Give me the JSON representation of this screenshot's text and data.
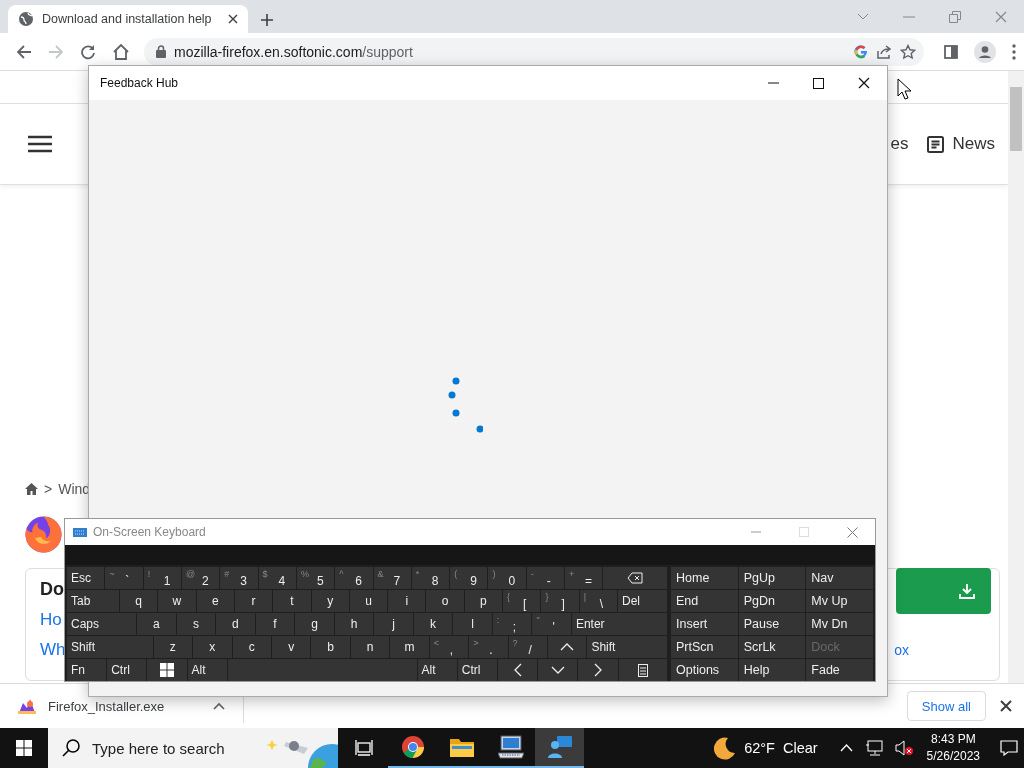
{
  "browser": {
    "tabs": [
      {
        "title": "Download and installation help",
        "selected": true
      }
    ],
    "nav": {
      "forward_disabled": true
    },
    "address": "mozilla-firefox.en.softonic.com/support"
  },
  "page": {
    "nav_items": [
      {
        "kind": "plain",
        "label": "es"
      },
      {
        "kind": "news",
        "label": "News"
      }
    ],
    "breadcrumb": {
      "separator": ">",
      "items": [
        "Wind"
      ]
    },
    "card": {
      "title": "Do",
      "links": [
        "Ho",
        "Wh"
      ],
      "side_link": "ox"
    }
  },
  "downloads": {
    "file": "Firefox_Installer.exe",
    "show_all": "Show all"
  },
  "feedback_hub": {
    "title": "Feedback Hub",
    "loading": true
  },
  "osk": {
    "title": "On-Screen Keyboard",
    "rows": [
      [
        {
          "kind": "key",
          "label": "Esc"
        },
        {
          "kind": "dual",
          "shift": "~",
          "label": "`"
        },
        {
          "kind": "dual",
          "shift": "!",
          "label": "1"
        },
        {
          "kind": "dual",
          "shift": "@",
          "label": "2"
        },
        {
          "kind": "dual",
          "shift": "#",
          "label": "3"
        },
        {
          "kind": "dual",
          "shift": "$",
          "label": "4"
        },
        {
          "kind": "dual",
          "shift": "%",
          "label": "5"
        },
        {
          "kind": "dual",
          "shift": "^",
          "label": "6"
        },
        {
          "kind": "dual",
          "shift": "&",
          "label": "7"
        },
        {
          "kind": "dual",
          "shift": "*",
          "label": "8"
        },
        {
          "kind": "dual",
          "shift": "(",
          "label": "9"
        },
        {
          "kind": "dual",
          "shift": ")",
          "label": "0"
        },
        {
          "kind": "dual",
          "shift": "-",
          "label": "-"
        },
        {
          "kind": "dual",
          "shift": "+",
          "label": "="
        },
        {
          "kind": "backspace"
        }
      ],
      [
        {
          "kind": "key",
          "label": "Tab"
        },
        {
          "kind": "key",
          "label": "q"
        },
        {
          "kind": "key",
          "label": "w"
        },
        {
          "kind": "key",
          "label": "e"
        },
        {
          "kind": "key",
          "label": "r"
        },
        {
          "kind": "key",
          "label": "t"
        },
        {
          "kind": "key",
          "label": "y"
        },
        {
          "kind": "key",
          "label": "u"
        },
        {
          "kind": "key",
          "label": "i"
        },
        {
          "kind": "key",
          "label": "o"
        },
        {
          "kind": "key",
          "label": "p"
        },
        {
          "kind": "dual",
          "shift": "{",
          "label": "["
        },
        {
          "kind": "dual",
          "shift": "}",
          "label": "]"
        },
        {
          "kind": "dual",
          "shift": "|",
          "label": "\\"
        },
        {
          "kind": "key",
          "label": "Del"
        }
      ],
      [
        {
          "kind": "key",
          "label": "Caps"
        },
        {
          "kind": "key",
          "label": "a"
        },
        {
          "kind": "key",
          "label": "s"
        },
        {
          "kind": "key",
          "label": "d"
        },
        {
          "kind": "key",
          "label": "f"
        },
        {
          "kind": "key",
          "label": "g"
        },
        {
          "kind": "key",
          "label": "h"
        },
        {
          "kind": "key",
          "label": "j"
        },
        {
          "kind": "key",
          "label": "k"
        },
        {
          "kind": "key",
          "label": "l"
        },
        {
          "kind": "dual",
          "shift": ":",
          "label": ";"
        },
        {
          "kind": "dual",
          "shift": "\"",
          "label": "'"
        },
        {
          "kind": "key",
          "label": "Enter"
        }
      ],
      [
        {
          "kind": "key",
          "label": "Shift"
        },
        {
          "kind": "key",
          "label": "z"
        },
        {
          "kind": "key",
          "label": "x"
        },
        {
          "kind": "key",
          "label": "c"
        },
        {
          "kind": "key",
          "label": "v"
        },
        {
          "kind": "key",
          "label": "b"
        },
        {
          "kind": "key",
          "label": "n"
        },
        {
          "kind": "key",
          "label": "m"
        },
        {
          "kind": "dual",
          "shift": "<",
          "label": ","
        },
        {
          "kind": "dual",
          "shift": ">",
          "label": "."
        },
        {
          "kind": "dual",
          "shift": "?",
          "label": "/"
        },
        {
          "kind": "up"
        },
        {
          "kind": "key",
          "label": "Shift"
        }
      ],
      [
        {
          "kind": "key",
          "label": "Fn"
        },
        {
          "kind": "key",
          "label": "Ctrl"
        },
        {
          "kind": "windows"
        },
        {
          "kind": "key",
          "label": "Alt"
        },
        {
          "kind": "space"
        },
        {
          "kind": "key",
          "label": "Alt"
        },
        {
          "kind": "key",
          "label": "Ctrl"
        },
        {
          "kind": "left"
        },
        {
          "kind": "down"
        },
        {
          "kind": "right"
        },
        {
          "kind": "menu"
        }
      ]
    ],
    "side_keys": [
      {
        "label": "Home",
        "disabled": false
      },
      {
        "label": "PgUp",
        "disabled": false
      },
      {
        "label": "Nav",
        "disabled": false
      },
      {
        "label": "End",
        "disabled": false
      },
      {
        "label": "PgDn",
        "disabled": false
      },
      {
        "label": "Mv Up",
        "disabled": false
      },
      {
        "label": "Insert",
        "disabled": false
      },
      {
        "label": "Pause",
        "disabled": false
      },
      {
        "label": "Mv Dn",
        "disabled": false
      },
      {
        "label": "PrtScn",
        "disabled": false
      },
      {
        "label": "ScrLk",
        "disabled": false
      },
      {
        "label": "Dock",
        "disabled": true
      },
      {
        "label": "Options",
        "disabled": false
      },
      {
        "label": "Help",
        "disabled": false
      },
      {
        "label": "Fade",
        "disabled": false
      }
    ]
  },
  "taskbar": {
    "search": {
      "placeholder": "Type here to search"
    },
    "apps": [
      {
        "kind": "chrome",
        "running": true,
        "selected": false
      },
      {
        "kind": "explorer",
        "running": true,
        "selected": false
      },
      {
        "kind": "keyboard",
        "running": true,
        "selected": false
      },
      {
        "kind": "feedback",
        "running": true,
        "selected": true
      }
    ],
    "weather": {
      "temperature": "62°F",
      "condition": "Clear"
    },
    "time": "8:43 PM",
    "date": "5/26/2023"
  }
}
